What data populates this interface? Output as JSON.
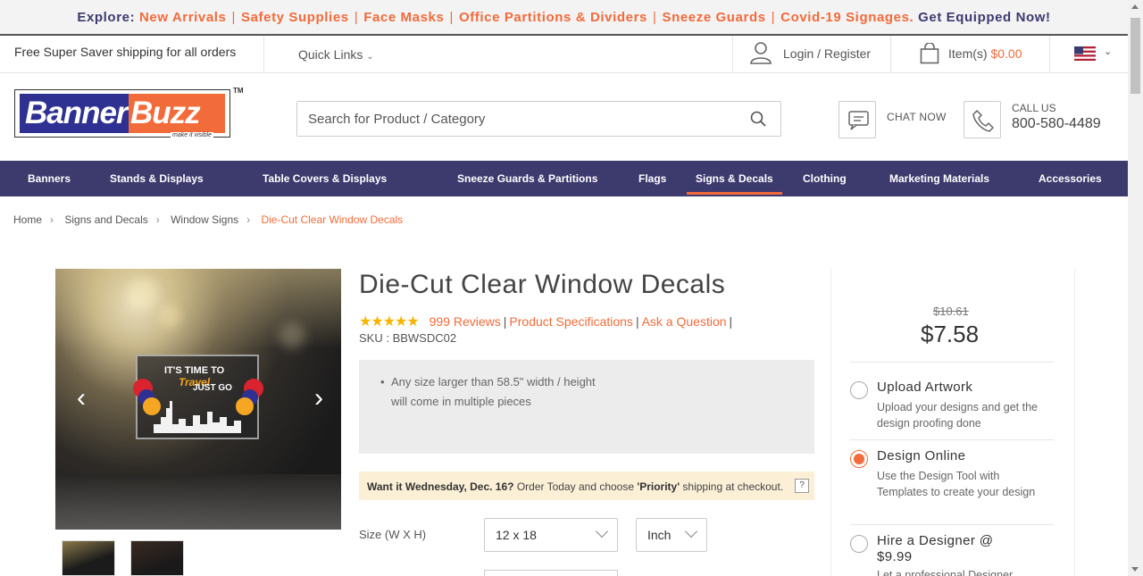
{
  "promo": {
    "prefix": "Explore:",
    "links": [
      "New Arrivals",
      "Safety Supplies",
      "Face Masks",
      "Office Partitions & Dividers",
      "Sneeze Guards",
      "Covid-19 Signages."
    ],
    "suffix": "Get Equipped Now!"
  },
  "util": {
    "shipping": "Free Super Saver shipping for all orders",
    "quick_links": "Quick Links",
    "login": "Login / Register",
    "cart_label": "Item(s)",
    "cart_amount": "$0.00"
  },
  "logo": {
    "part1": "Banner",
    "part2": "Buzz",
    "tagline": "make it visible",
    "tm": "TM"
  },
  "search": {
    "placeholder": "Search for Product / Category"
  },
  "chat": {
    "label": "CHAT NOW"
  },
  "call": {
    "label": "CALL US",
    "number": "800-580-4489"
  },
  "nav": [
    "Banners",
    "Stands & Displays",
    "Table Covers & Displays",
    "Sneeze Guards & Partitions",
    "Flags",
    "Signs & Decals",
    "Clothing",
    "Marketing Materials",
    "Accessories"
  ],
  "breadcrumb": [
    "Home",
    "Signs and Decals",
    "Window Signs",
    "Die-Cut Clear Window Decals"
  ],
  "gallery": {
    "decal_line1": "IT'S TIME TO",
    "decal_line2": "Travel",
    "decal_line3": "JUST GO"
  },
  "product": {
    "title": "Die-Cut Clear Window Decals",
    "stars": "★★★★★",
    "reviews": "999 Reviews",
    "specs": "Product Specifications",
    "ask": "Ask a Question",
    "sku": "SKU : BBWSDC02",
    "note": "Any size larger than 58.5\" width / height will come in multiple pieces",
    "delivery_bold": "Want it Wednesday, Dec. 16?",
    "delivery_mid": " Order Today and choose ",
    "delivery_priority": "'Priority'",
    "delivery_end": " shipping at checkout.",
    "delivery_help": "?",
    "size_label": "Size (W X H)",
    "size_value": "12 x 18",
    "unit_value": "Inch"
  },
  "pricing": {
    "old_price": "$10.61",
    "price": "$7.58",
    "options": [
      {
        "title": "Upload Artwork",
        "desc": "Upload your designs and get the design proofing done",
        "selected": false
      },
      {
        "title": "Design Online",
        "desc": "Use the Design Tool with Templates to create your design",
        "selected": true
      },
      {
        "title": "Hire a Designer @ $9.99",
        "desc": "Let a professional Designer",
        "selected": false
      }
    ]
  },
  "colors": {
    "brand_purple": "#3d3a6e",
    "brand_orange": "#f26b3a",
    "logo_blue": "#2e3192",
    "star": "#f7b500"
  }
}
